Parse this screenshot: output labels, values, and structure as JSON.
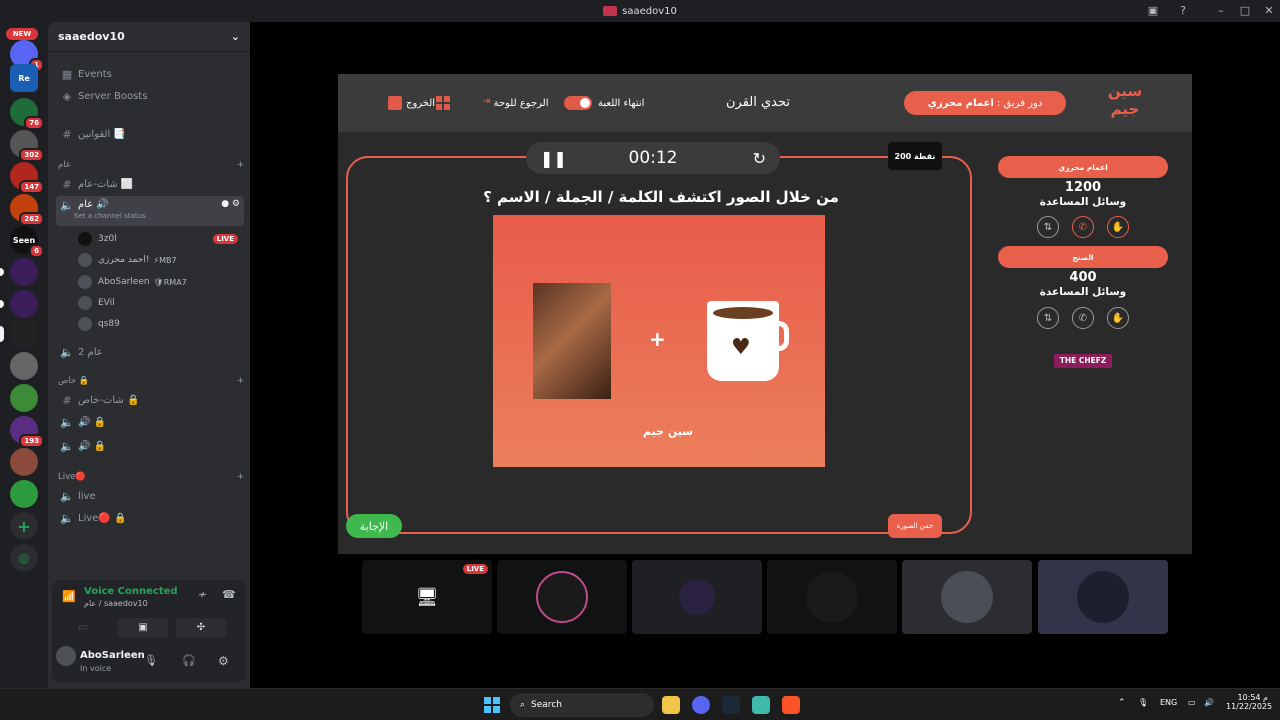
{
  "window": {
    "title": "saaedov10"
  },
  "server_rail": {
    "new_label": "NEW",
    "servers": [
      {
        "icon": "server-icon",
        "badge": "1"
      },
      {
        "icon": "re-server-icon",
        "label": "Re",
        "badge": ""
      },
      {
        "icon": "server-icon",
        "badge": "76"
      },
      {
        "icon": "server-icon",
        "badge": "302"
      },
      {
        "icon": "server-icon",
        "badge": "147"
      },
      {
        "icon": "server-icon",
        "badge": "262"
      },
      {
        "icon": "seen-server-icon",
        "label": "Seen",
        "badge": "6"
      },
      {
        "icon": "server-icon",
        "badge": ""
      },
      {
        "icon": "server-icon",
        "badge": ""
      },
      {
        "icon": "server-icon",
        "badge": ""
      },
      {
        "icon": "server-icon",
        "badge": ""
      },
      {
        "icon": "server-icon",
        "badge": ""
      },
      {
        "icon": "server-icon",
        "badge": "193"
      },
      {
        "icon": "server-icon",
        "badge": ""
      },
      {
        "icon": "server-icon",
        "badge": ""
      }
    ]
  },
  "sidebar": {
    "server_name": "saaedov10",
    "events": "Events",
    "boosts": "Server Boosts",
    "rules_channel": "القوانين 📑",
    "cat_general": "عام",
    "chat_general": "شات-عام ⬜",
    "voice_general": "عام 🔊",
    "channel_status": "Set a channel status",
    "users": [
      {
        "name": "3z0l",
        "extra": "",
        "live": "LIVE"
      },
      {
        "name": "احمد محرزي!",
        "extra": "⚡MB7",
        "live": ""
      },
      {
        "name": "AboSarleen",
        "extra": "🛡RMA7",
        "live": ""
      },
      {
        "name": "EVil",
        "extra": "",
        "live": ""
      },
      {
        "name": "qs89",
        "extra": "",
        "live": ""
      }
    ],
    "voice_general2": "عام 2",
    "cat_private": "خاص 🔒",
    "chat_private": "شات-خاص 🔒",
    "voice_private1": "🔊 🔒",
    "voice_private2": "🔊 🔒",
    "cat_live": "Live🔴",
    "live_voice": "live",
    "live_voice2": "Live🔴 🔒",
    "voice_connected": "Voice Connected",
    "voice_location": "عام / saaedov10",
    "user_name": "AboSarleen",
    "user_status": "In voice"
  },
  "game": {
    "logo": "سين جيم",
    "team_turn_prefix": "دور فريق :",
    "team_turn_name": "اعمام محرزي",
    "title": "تحدي القرن",
    "end_game": "انتهاء اللعبة",
    "back_board": "الرجوع للوحة",
    "exit": "الخروج",
    "timer": "00:12",
    "points": "200 نقطة",
    "question": "من خلال الصور اكتشف الكلمة / الجملة / الاسم ؟",
    "plus": "+",
    "answer_button": "الإجابة",
    "guess_button": "خمن الصورة",
    "teams": [
      {
        "name": "اعمام محرزي",
        "score": "1200",
        "assist_label": "وسائل المساعدة"
      },
      {
        "name": "الصنج",
        "score": "400",
        "assist_label": "وسائل المساعدة"
      }
    ],
    "sponsor": "THE CHEFZ"
  },
  "streams": {
    "live_label": "LIVE",
    "tiles": [
      "screen-share",
      "3z0l",
      "AboSarleen",
      "EVil",
      "qs89",
      "user"
    ]
  },
  "taskbar": {
    "search_placeholder": "Search",
    "lang": "ENG",
    "time": "10:54 م",
    "date": "11/22/2025"
  }
}
